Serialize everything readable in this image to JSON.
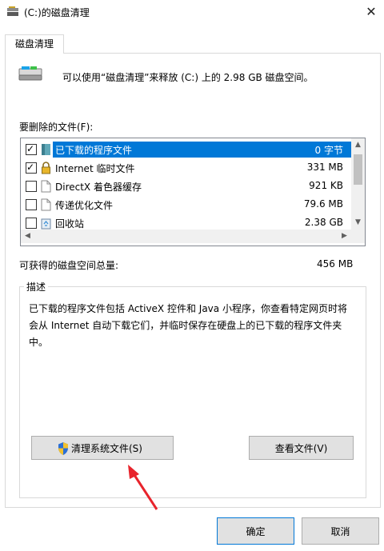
{
  "window": {
    "title": "(C:)的磁盘清理",
    "close_glyph": "✕"
  },
  "tabs": [
    {
      "label": "磁盘清理"
    }
  ],
  "drive_info": "可以使用“磁盘清理”来释放 (C:) 上的 2.98 GB 磁盘空间。",
  "files_to_delete_label": "要删除的文件(F):",
  "files": [
    {
      "name": "已下载的程序文件",
      "size": "0 字节",
      "checked": true,
      "selected": true,
      "icon": "folder-icon"
    },
    {
      "name": "Internet 临时文件",
      "size": "331 MB",
      "checked": true,
      "selected": false,
      "icon": "lock-icon"
    },
    {
      "name": "DirectX 着色器缓存",
      "size": "921 KB",
      "checked": false,
      "selected": false,
      "icon": "file-icon"
    },
    {
      "name": "传递优化文件",
      "size": "79.6 MB",
      "checked": false,
      "selected": false,
      "icon": "file-icon"
    },
    {
      "name": "回收站",
      "size": "2.38 GB",
      "checked": false,
      "selected": false,
      "icon": "recycle-bin-icon"
    }
  ],
  "space_total_label": "可获得的磁盘空间总量:",
  "space_total_value": "456 MB",
  "description": {
    "title": "描述",
    "text": "已下载的程序文件包括 ActiveX 控件和 Java 小程序，你查看特定网页时将会从 Internet 自动下载它们，并临时保存在硬盘上的已下载的程序文件夹中。"
  },
  "buttons": {
    "clean_system": "清理系统文件(S)",
    "view_files": "查看文件(V)",
    "ok": "确定",
    "cancel": "取消"
  },
  "colors": {
    "accent": "#0078d7",
    "arrow": "#e8242c",
    "button_bg": "#e1e1e1"
  }
}
